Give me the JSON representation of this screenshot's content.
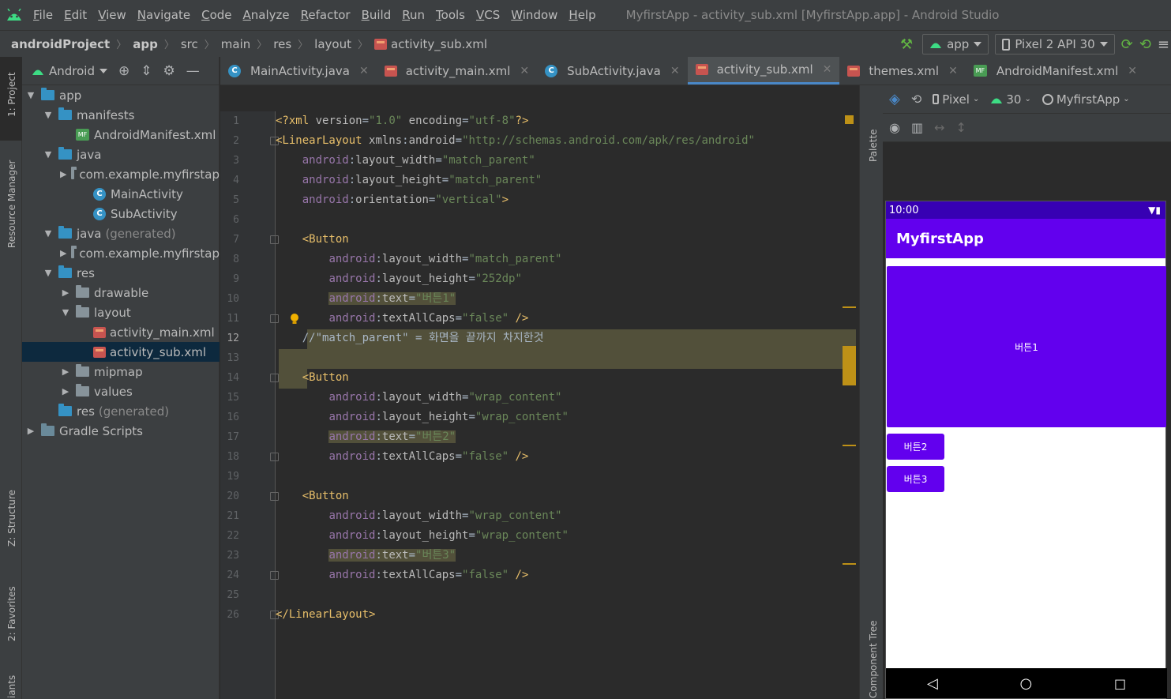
{
  "menubar": {
    "items": [
      "File",
      "Edit",
      "View",
      "Navigate",
      "Code",
      "Analyze",
      "Refactor",
      "Build",
      "Run",
      "Tools",
      "VCS",
      "Window",
      "Help"
    ],
    "window_title": "MyfirstApp - activity_sub.xml [MyfirstApp.app] - Android Studio"
  },
  "breadcrumb": [
    "androidProject",
    "app",
    "src",
    "main",
    "res",
    "layout",
    "activity_sub.xml"
  ],
  "toolbar": {
    "run_config": "app",
    "device": "Pixel 2 API 30"
  },
  "leftstrip": {
    "project": "1: Project",
    "resource_manager": "Resource Manager",
    "structure": "Z: Structure",
    "favorites": "2: Favorites",
    "variants": "iants"
  },
  "project_panel": {
    "view_mode": "Android",
    "tree": [
      {
        "label": "app",
        "indent": 0
      },
      {
        "label": "manifests",
        "indent": 1
      },
      {
        "label": "AndroidManifest.xml",
        "indent": 2
      },
      {
        "label": "java",
        "indent": 1
      },
      {
        "label": "com.example.myfirstap",
        "indent": 2
      },
      {
        "label": "MainActivity",
        "indent": 3
      },
      {
        "label": "SubActivity",
        "indent": 3
      },
      {
        "label": "java",
        "suffix": "(generated)",
        "indent": 1
      },
      {
        "label": "com.example.myfirstap",
        "indent": 2
      },
      {
        "label": "res",
        "indent": 1
      },
      {
        "label": "drawable",
        "indent": 2
      },
      {
        "label": "layout",
        "indent": 2
      },
      {
        "label": "activity_main.xml",
        "indent": 3
      },
      {
        "label": "activity_sub.xml",
        "indent": 3
      },
      {
        "label": "mipmap",
        "indent": 2
      },
      {
        "label": "values",
        "indent": 2
      },
      {
        "label": "res",
        "suffix": "(generated)",
        "indent": 1
      },
      {
        "label": "Gradle Scripts",
        "indent": 0
      }
    ]
  },
  "tabs": [
    {
      "label": "MainActivity.java",
      "icon": "java-class-icon"
    },
    {
      "label": "activity_main.xml",
      "icon": "layout-xml-icon"
    },
    {
      "label": "SubActivity.java",
      "icon": "java-class-icon"
    },
    {
      "label": "activity_sub.xml",
      "icon": "layout-xml-icon",
      "active": true
    },
    {
      "label": "themes.xml",
      "icon": "layout-xml-icon"
    },
    {
      "label": "AndroidManifest.xml",
      "icon": "manifest-icon"
    }
  ],
  "editor": {
    "current_line": 12,
    "line_numbers": [
      "1",
      "2",
      "3",
      "4",
      "5",
      "6",
      "7",
      "8",
      "9",
      "10",
      "11",
      "12",
      "13",
      "14",
      "15",
      "16",
      "17",
      "18",
      "19",
      "20",
      "21",
      "22",
      "23",
      "24",
      "25",
      "26"
    ],
    "lines": [
      "<?xml version=\"1.0\" encoding=\"utf-8\"?>",
      "<LinearLayout xmlns:android=\"http://schemas.android.com/apk/res/android\"",
      "    android:layout_width=\"match_parent\"",
      "    android:layout_height=\"match_parent\"",
      "    android:orientation=\"vertical\">",
      "",
      "    <Button",
      "        android:layout_width=\"match_parent\"",
      "        android:layout_height=\"252dp\"",
      "        android:text=\"버튼1\"",
      "        android:textAllCaps=\"false\" />",
      "    //\"match_parent\" = 화면을 끝까지 차지한것",
      "",
      "    <Button",
      "        android:layout_width=\"wrap_content\"",
      "        android:layout_height=\"wrap_content\"",
      "        android:text=\"버튼2\"",
      "        android:textAllCaps=\"false\" />",
      "",
      "    <Button",
      "        android:layout_width=\"wrap_content\"",
      "        android:layout_height=\"wrap_content\"",
      "        android:text=\"버튼3\"",
      "        android:textAllCaps=\"false\" />",
      "",
      "</LinearLayout>"
    ]
  },
  "design": {
    "palette_label": "Palette",
    "component_tree_label": "Component Tree",
    "device": "Pixel",
    "api": "30",
    "theme": "MyfirstApp",
    "phone": {
      "time": "10:00",
      "app_title": "MyfirstApp",
      "button1": "버튼1",
      "button2": "버튼2",
      "button3": "버튼3"
    }
  },
  "colors": {
    "primary": "#6200ee",
    "primary_dark": "#3700b3",
    "android_green": "#3ddc84"
  }
}
